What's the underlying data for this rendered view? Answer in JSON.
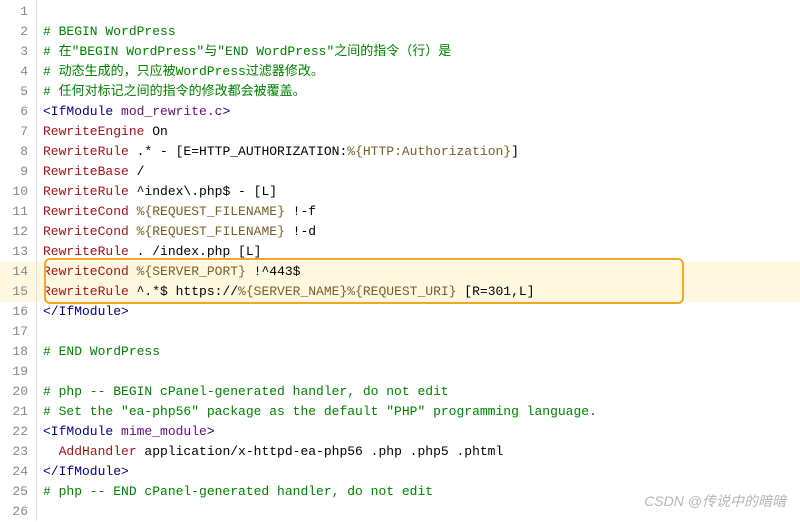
{
  "editor": {
    "line_count": 26,
    "highlighted_lines": [
      14,
      15
    ],
    "code": {
      "l1": "",
      "l2_comment": "# BEGIN WordPress",
      "l3_comment": "# 在\"BEGIN WordPress\"与\"END WordPress\"之间的指令（行）是",
      "l4_comment": "# 动态生成的，只应被WordPress过滤器修改。",
      "l5_comment": "# 任何对标记之间的指令的修改都会被覆盖。",
      "l6_tag_open": "<IfModule",
      "l6_attr": " mod_rewrite.c",
      "l6_close": ">",
      "l7_dir": "RewriteEngine",
      "l7_rest": " On",
      "l8_dir": "RewriteRule",
      "l8_rest": " .* - [E=HTTP_AUTHORIZATION:",
      "l8_var": "%{HTTP:Authorization}",
      "l8_end": "]",
      "l9_dir": "RewriteBase",
      "l9_rest": " /",
      "l10_dir": "RewriteRule",
      "l10_rest": " ^index\\.php$ - [L]",
      "l11_dir": "RewriteCond",
      "l11_sp": " ",
      "l11_var": "%{REQUEST_FILENAME}",
      "l11_end": " !-f",
      "l12_dir": "RewriteCond",
      "l12_sp": " ",
      "l12_var": "%{REQUEST_FILENAME}",
      "l12_end": " !-d",
      "l13_dir": "RewriteRule",
      "l13_rest": " . /index.php [L]",
      "l14_dir": "RewriteCond",
      "l14_sp": " ",
      "l14_var": "%{SERVER_PORT}",
      "l14_end": " !^443$",
      "l15_dir": "RewriteRule",
      "l15_rest": " ^.*$ https://",
      "l15_var1": "%{SERVER_NAME}",
      "l15_var2": "%{REQUEST_URI}",
      "l15_end": " [R=301,L]",
      "l16_tag": "</IfModule>",
      "l17": "",
      "l18_comment": "# END WordPress",
      "l19": "",
      "l20_comment": "# php -- BEGIN cPanel-generated handler, do not edit",
      "l21_comment": "# Set the \"ea-php56\" package as the default \"PHP\" programming language.",
      "l22_tag_open": "<IfModule",
      "l22_attr": " mime_module",
      "l22_close": ">",
      "l23_indent": "  ",
      "l23_dir": "AddHandler",
      "l23_rest": " application/x-httpd-ea-php56 .php .php5 .phtml",
      "l24_tag": "</IfModule>",
      "l25_comment": "# php -- END cPanel-generated handler, do not edit",
      "l26": ""
    }
  },
  "watermark": "CSDN @传说中的暗暗"
}
